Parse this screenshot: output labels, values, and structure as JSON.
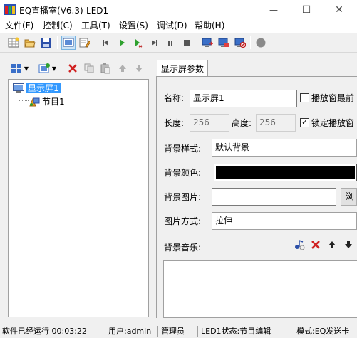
{
  "window": {
    "title": "EQ直播室(V6.3)-LED1",
    "controls": {
      "minimize": "—",
      "maximize": "☐",
      "close": "✕"
    }
  },
  "menu": {
    "items": [
      "文件(F)",
      "控制(C)",
      "工具(T)",
      "设置(S)",
      "调试(D)",
      "帮助(H)"
    ]
  },
  "toolbar": {
    "icons": [
      "new-icon",
      "open-icon",
      "save-icon",
      "screen-view-icon",
      "edit-view-icon",
      "first-icon",
      "play-icon",
      "step-icon",
      "next-icon",
      "pause-icon",
      "stop-icon",
      "send-icon",
      "send-all-icon",
      "settings-icon",
      "record-icon"
    ]
  },
  "tree": {
    "root": "显示屏1",
    "child": "节目1"
  },
  "properties": {
    "tab": "显示屏参数",
    "name_label": "名称:",
    "name_value": "显示屏1",
    "play_front_label": "播放窗最前",
    "width_label": "长度:",
    "width_value": "256",
    "height_label": "高度:",
    "height_value": "256",
    "lock_label": "锁定播放窗",
    "lock_checked": "✓",
    "bg_style_label": "背景样式:",
    "bg_style_value": "默认背景",
    "bg_color_label": "背景颜色:",
    "bg_color": "#000000",
    "bg_image_label": "背景图片:",
    "bg_image_value": "",
    "browse_label": "浏",
    "image_mode_label": "图片方式:",
    "image_mode_value": "拉伸",
    "bg_music_label": "背景音乐:"
  },
  "status": {
    "runtime": "软件已经运行 00:03:22",
    "user": "用户:admin",
    "role": "管理员",
    "led_state": "LED1状态:节目编辑",
    "mode": "模式:EQ发送卡"
  }
}
